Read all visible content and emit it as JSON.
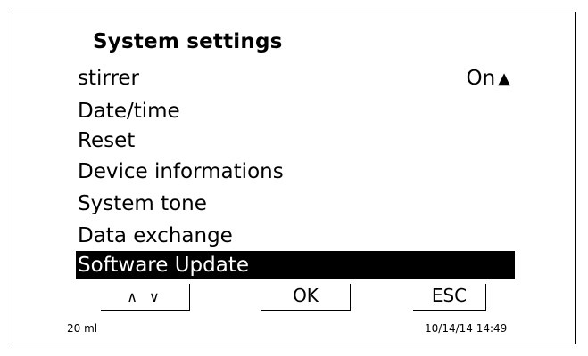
{
  "title": "System settings",
  "menu": [
    {
      "label": "stirrer",
      "value": "On"
    },
    {
      "label": "Date/time"
    },
    {
      "label": "Reset"
    },
    {
      "label": "Device informations"
    },
    {
      "label": "System tone"
    },
    {
      "label": "Data exchange"
    },
    {
      "label": "Software Update",
      "selected": true
    }
  ],
  "softkeys": {
    "nav_label": "∧ ∨",
    "ok_label": "OK",
    "esc_label": "ESC"
  },
  "status": {
    "volume": "20 ml",
    "datetime": "10/14/14 14:49"
  },
  "icons": {
    "value_indicator": "triangle-up-icon"
  },
  "colors": {
    "selection_bg": "#000000",
    "selection_fg": "#ffffff"
  }
}
